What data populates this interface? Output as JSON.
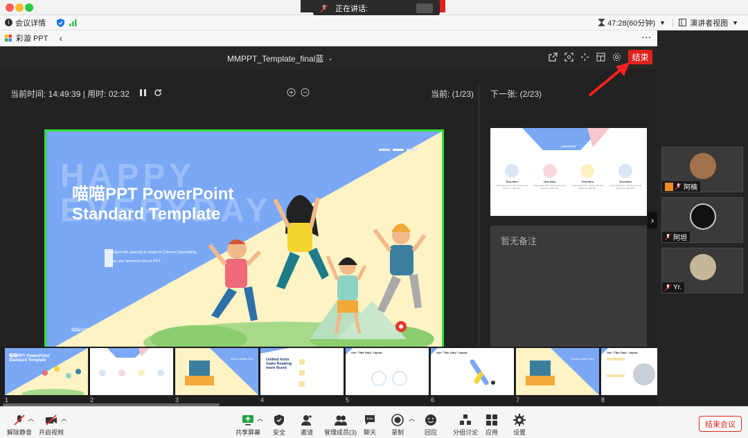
{
  "speaking_label": "正在讲话:",
  "topbar": {
    "meeting_info": "会议详情",
    "timer": "47:28(60分钟)",
    "view_mode": "演讲者视图"
  },
  "app": {
    "name": "彩漩 PPT"
  },
  "ppt": {
    "file_name": "MMPPT_Template_final蓝",
    "end_button": "结束",
    "clock_text": "当前时间: 14:49:39 | 用时: 02:32",
    "current_page": "当前: (1/23)",
    "next_label": "下一张: (2/23)",
    "notes": "暂无备注"
  },
  "slide": {
    "title_line1": "喵喵PPT PowerPoint",
    "title_line2": "Standard Template",
    "subtitle_line1": "Adjust the spacing to adapt to Chinese typesetting,",
    "subtitle_line2": "use the reference line in PPT",
    "bg_text1": "HAPPY",
    "bg_text2": "EVERYDAY",
    "logo": "喵喵PPT"
  },
  "next_slide": {
    "header": "CONTENTS",
    "items": [
      {
        "title": "Text Here",
        "desc": "Copy paste fonts. Choose the only option to retain text."
      },
      {
        "title": "Text Here",
        "desc": "Copy paste fonts. Choose the only option to retain text."
      },
      {
        "title": "Text Here",
        "desc": "Copy paste fonts. Choose the only option to retain text."
      },
      {
        "title": "Text Here",
        "desc": "Copy paste fonts. Choose the only option to retain text."
      }
    ]
  },
  "thumbnails": [
    {
      "num": "1",
      "title": "喵喵PPT PowerPoint Standard Template"
    },
    {
      "num": "2",
      "title": ""
    },
    {
      "num": "3",
      "title": "Section Header Here"
    },
    {
      "num": "4",
      "title": "Unified fonts make Reading more fluent"
    },
    {
      "num": "5",
      "title": "Use \"Title Only\" Layout"
    },
    {
      "num": "6",
      "title": "Use \"Title Only\" Layout"
    },
    {
      "num": "7",
      "title": "Section Header Here"
    },
    {
      "num": "8",
      "title": "Use \"Title Only\" Layout"
    }
  ],
  "participants": [
    {
      "name": "阿楠"
    },
    {
      "name": "阿坦"
    },
    {
      "name": "Yr."
    }
  ],
  "bottombar": {
    "mute": "解除静音",
    "video": "开启视频",
    "share": "共享屏幕",
    "security": "安全",
    "invite": "邀请",
    "manage": "管理成员(3)",
    "chat": "聊天",
    "record": "录制",
    "react": "回应",
    "breakout": "分组讨论",
    "apps": "应用",
    "settings": "设置",
    "end_meeting": "结束会议"
  },
  "colors": {
    "end_red": "#e0221c",
    "slide_border": "#33e033",
    "slide_blue": "#7aa8f5",
    "slide_yellow": "#fdf3c4"
  }
}
